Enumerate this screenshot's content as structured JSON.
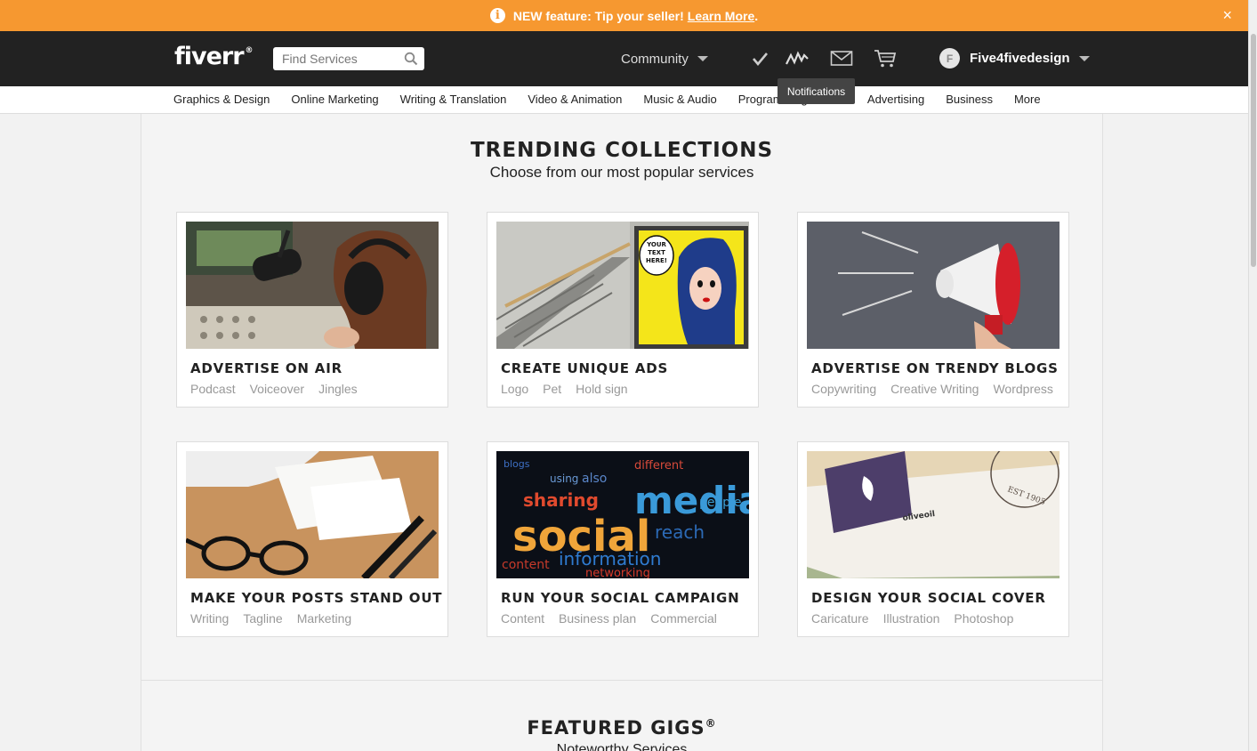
{
  "banner": {
    "text": "NEW feature: Tip your seller!",
    "link": "Learn More",
    "period": ".",
    "close": "×"
  },
  "header": {
    "logo": "fiverr",
    "logo_mark": "®",
    "search_placeholder": "Find Services",
    "community": "Community",
    "avatar_initial": "F",
    "username": "Five4fivedesign",
    "tooltip": "Notifications",
    "icons": [
      "search-icon",
      "checkmark-icon",
      "notifications-icon",
      "mail-icon",
      "cart-icon"
    ]
  },
  "categories": [
    "Graphics & Design",
    "Online Marketing",
    "Writing & Translation",
    "Video & Animation",
    "Music & Audio",
    "Programming & Tech",
    "Advertising",
    "Business",
    "More"
  ],
  "trending": {
    "title": "TRENDING COLLECTIONS",
    "subtitle": "Choose from our most popular services",
    "cards": [
      {
        "title": "ADVERTISE ON AIR",
        "tags": [
          "Podcast",
          "Voiceover",
          "Jingles"
        ]
      },
      {
        "title": "CREATE UNIQUE ADS",
        "tags": [
          "Logo",
          "Pet",
          "Hold sign"
        ]
      },
      {
        "title": "ADVERTISE ON TRENDY BLOGS",
        "tags": [
          "Copywriting",
          "Creative Writing",
          "Wordpress"
        ]
      },
      {
        "title": "MAKE YOUR POSTS STAND OUT",
        "tags": [
          "Writing",
          "Tagline",
          "Marketing"
        ]
      },
      {
        "title": "RUN YOUR SOCIAL CAMPAIGN",
        "tags": [
          "Content",
          "Business plan",
          "Commercial"
        ]
      },
      {
        "title": "DESIGN YOUR SOCIAL COVER",
        "tags": [
          "Caricature",
          "Illustration",
          "Photoshop"
        ]
      }
    ]
  },
  "image_text": {
    "poster": [
      "YOUR",
      "TEXT",
      "HERE!"
    ],
    "social": [
      "social",
      "media",
      "sharing",
      "information",
      "content",
      "reach",
      "networking",
      "people",
      "different",
      "using",
      "blogs",
      "also"
    ],
    "cover_name": "oliveoil",
    "stamp": "EST 1905"
  },
  "featured": {
    "title": "FEATURED GIGS",
    "mark": "®",
    "subtitle": "Noteworthy Services"
  },
  "colors": {
    "banner": "#f69830",
    "header": "#222222",
    "page_bg": "#f4f4f4"
  }
}
